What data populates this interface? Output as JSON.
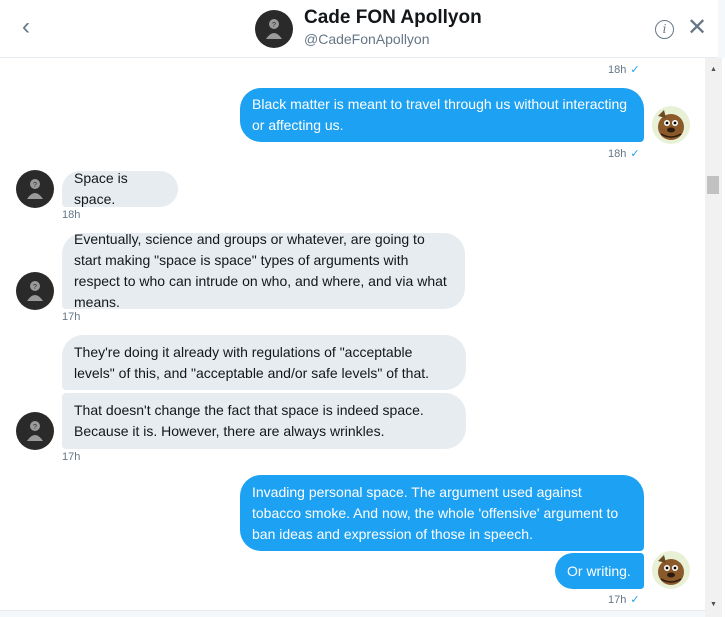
{
  "header": {
    "back_icon": "chevron-left-icon",
    "name": "Cade FON Apollyon",
    "handle": "@CadeFonApollyon",
    "info_icon": "info-icon",
    "close_icon": "close-icon"
  },
  "messages": [
    {
      "ts": "18h",
      "check": "✓"
    },
    {
      "text": "Black matter is meant to travel through us without interacting or affecting us.",
      "ts": "18h",
      "check": "✓"
    },
    {
      "text": "Space is space.",
      "ts": "18h"
    },
    {
      "text": "Eventually, science and groups or whatever, are going to start making \"space is space\" types of arguments with respect to who can intrude on who, and where, and via what means.",
      "ts": "17h"
    },
    {
      "text": "They're doing it already with regulations of \"acceptable levels\" of this, and \"acceptable and/or safe levels\" of that."
    },
    {
      "text": "That doesn't change the fact that space is indeed space. Because it is. However, there are always wrinkles.",
      "ts": "17h"
    },
    {
      "text": "Invading personal space. The argument used against tobacco smoke. And now, the whole 'offensive' argument to ban ideas and expression of those in speech."
    },
    {
      "text": "Or writing.",
      "ts": "17h",
      "check": "✓"
    }
  ],
  "colors": {
    "outgoing": "#1da1f2",
    "incoming": "#e6ecf0",
    "muted": "#657786"
  }
}
